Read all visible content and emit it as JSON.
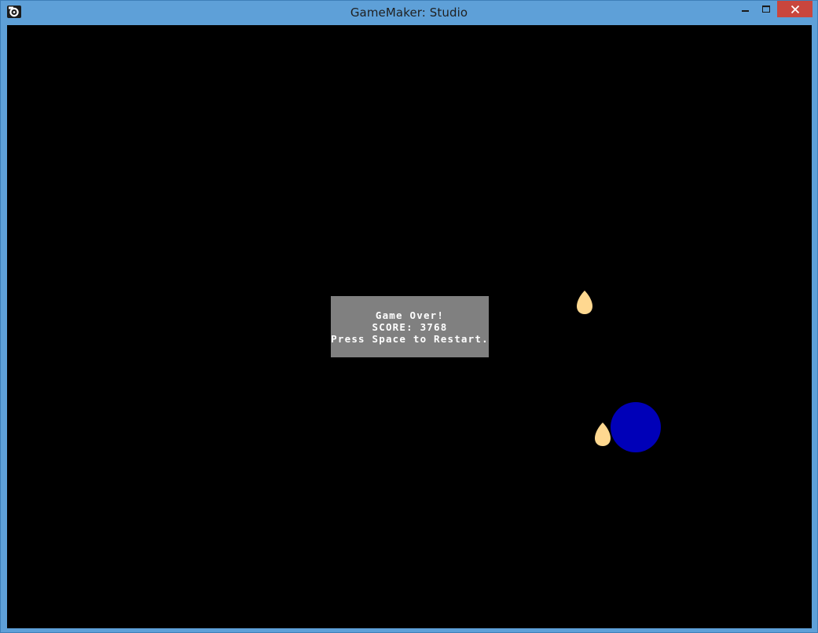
{
  "window": {
    "title": "GameMaker: Studio",
    "icon": "gamemaker-logo-icon",
    "controls": {
      "minimize": "minimize-icon",
      "maximize": "maximize-icon",
      "close": "close-icon"
    },
    "frame_color": "#5ea0d8",
    "close_button_color": "#c9463d"
  },
  "game": {
    "background_color": "#000000",
    "game_over_dialog": {
      "line1": "Game Over!",
      "line2": "SCORE: 3768",
      "line3": "Press Space to Restart."
    },
    "dialog_color": "#808080",
    "player_color": "#0000b8",
    "egg_color": "#ffd890",
    "objects": [
      "egg",
      "egg",
      "player-ball"
    ]
  }
}
